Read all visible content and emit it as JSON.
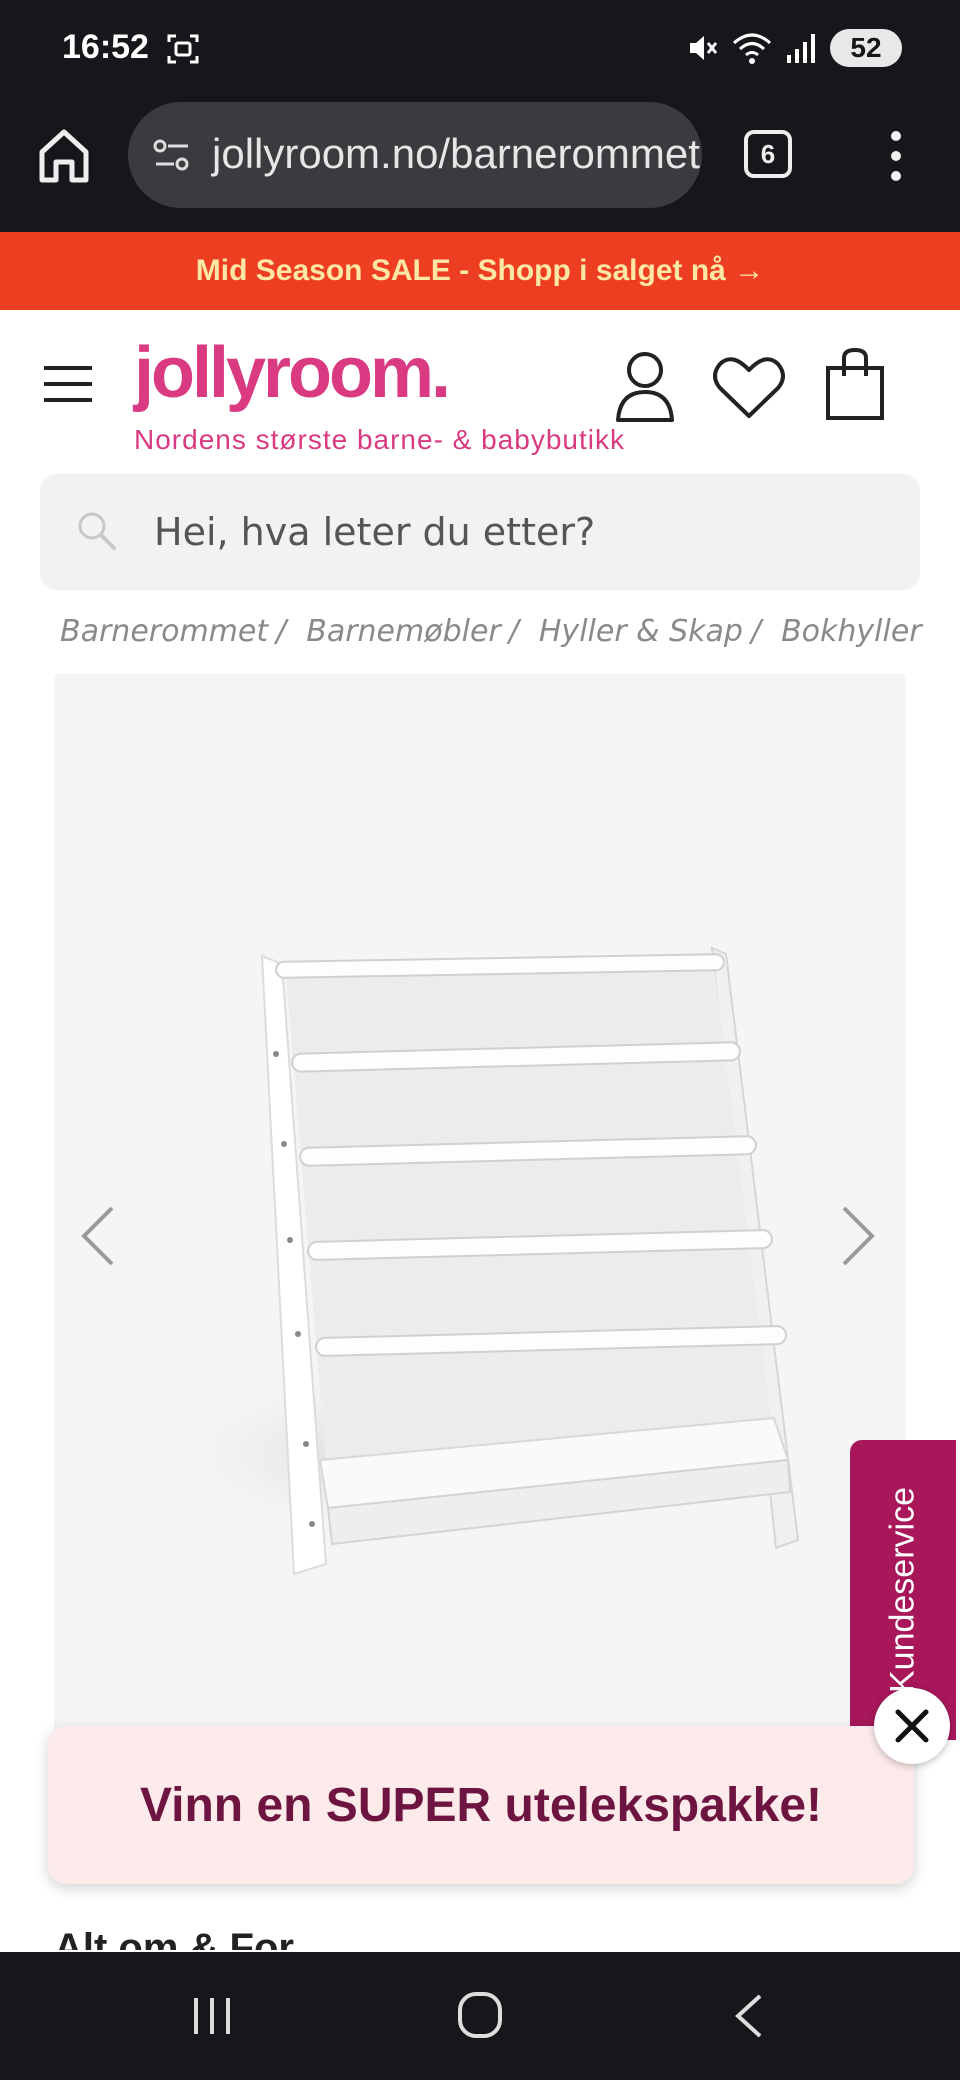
{
  "status_bar": {
    "time": "16:52",
    "battery": "52",
    "icons": [
      "screen-record-icon",
      "mute-icon",
      "wifi-icon",
      "signal-icon",
      "battery-icon"
    ]
  },
  "browser": {
    "url": "jollyroom.no/barnerommet",
    "tab_count": "6",
    "icons": [
      "home-icon",
      "site-settings-icon",
      "tabs-icon",
      "more-vert-icon"
    ]
  },
  "promo": {
    "text": "Mid Season SALE - Shopp i salget nå →",
    "background": "#ee3e22",
    "text_color": "#fde7a4"
  },
  "header": {
    "logo": "jollyroom.",
    "tagline": "Nordens største barne- & babybutikk",
    "brand_color": "#d93a81",
    "icons": [
      "menu-icon",
      "account-icon",
      "heart-icon",
      "shopping-bag-icon"
    ]
  },
  "search": {
    "placeholder": "Hei, hva leter du etter?"
  },
  "breadcrumb": [
    "Barnerommet",
    "Barnemøbler",
    "Hyller & Skap",
    "Bokhyller"
  ],
  "breadcrumb_separator": "/",
  "gallery": {
    "image_alt": "Hvit bokhylle med stoffhyller",
    "icons": [
      "chevron-left-icon",
      "chevron-right-icon"
    ]
  },
  "kundeservice": {
    "label": "Kundeservice",
    "color": "#a7175a"
  },
  "popup": {
    "text": "Vinn en SUPER utelekspakke!",
    "text_color": "#6d1540",
    "background": "#fdeaea"
  },
  "partial_heading": "Alt om & For",
  "nav": {
    "icons": [
      "recents-icon",
      "home-circle-icon",
      "back-icon"
    ]
  }
}
